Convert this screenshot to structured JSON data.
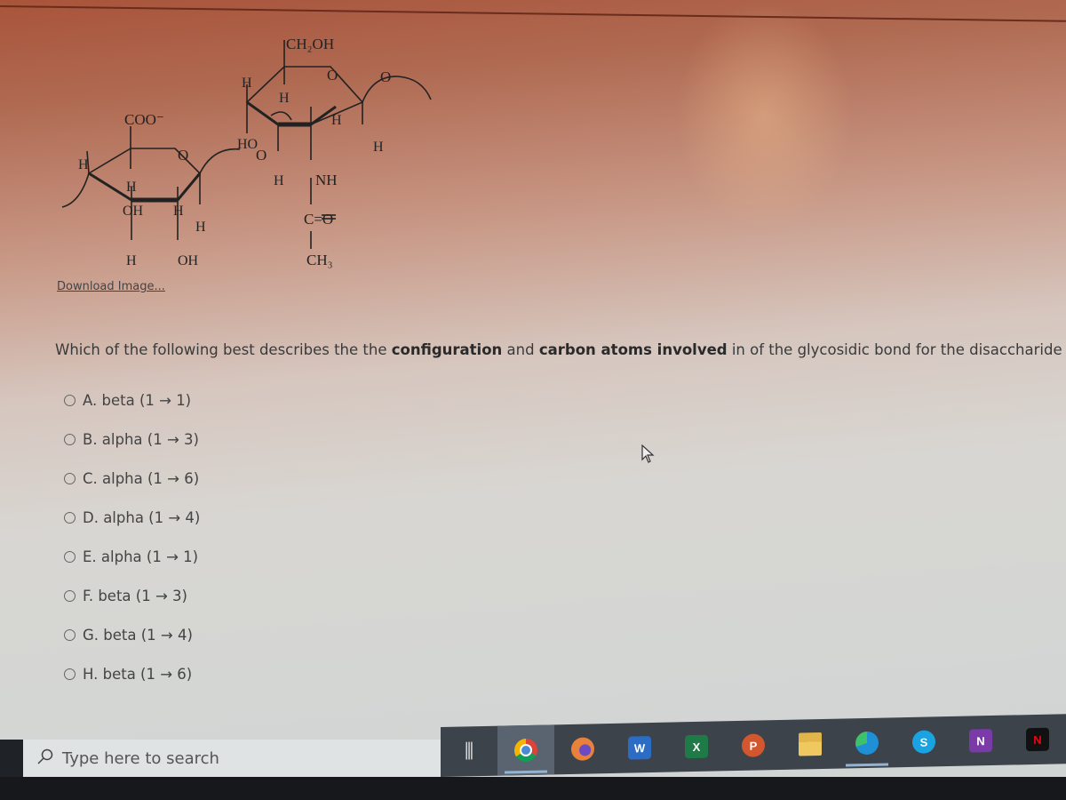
{
  "figure": {
    "labels": {
      "ch2oh": "CH₂OH",
      "coo": "COO⁻",
      "ho": "HO",
      "nh": "NH",
      "co": "C=O",
      "ch3": "CH₃",
      "oh": "OH",
      "h": "H",
      "o": "O"
    },
    "download_link": "Download Image..."
  },
  "question": {
    "part1": "Which of the following best describes the the ",
    "bold1": "configuration",
    "part2": " and ",
    "bold2": "carbon atoms involved",
    "part3": " in of the glycosidic bond for the disaccharide unit?"
  },
  "options": [
    {
      "label": "A. beta (1 → 1)"
    },
    {
      "label": "B. alpha (1 → 3)"
    },
    {
      "label": "C. alpha (1 → 6)"
    },
    {
      "label": "D. alpha (1 → 4)"
    },
    {
      "label": "E. alpha (1 → 1)"
    },
    {
      "label": "F. beta (1 → 3)"
    },
    {
      "label": "G. beta (1 → 4)"
    },
    {
      "label": "H. beta (1 → 6)"
    }
  ],
  "taskbar": {
    "search_placeholder": "Type here to search",
    "apps": [
      {
        "name": "task-view",
        "glyph": "⧉"
      },
      {
        "name": "chrome",
        "glyph": "",
        "color": "#4a8ad4",
        "active": true
      },
      {
        "name": "firefox",
        "glyph": "",
        "color": "#e8813a"
      },
      {
        "name": "word",
        "glyph": "W",
        "color": "#2b6cc4"
      },
      {
        "name": "excel",
        "glyph": "X",
        "color": "#1e7a46"
      },
      {
        "name": "powerpoint",
        "glyph": "P",
        "color": "#d2572e"
      },
      {
        "name": "file-explorer",
        "glyph": "",
        "color": "#e2b54a"
      },
      {
        "name": "edge",
        "glyph": "",
        "color": "#1f8fd6",
        "underline": true
      },
      {
        "name": "skype",
        "glyph": "S",
        "color": "#1aa3e0"
      },
      {
        "name": "onenote",
        "glyph": "N",
        "color": "#7a3aa8"
      },
      {
        "name": "netflix",
        "glyph": "N",
        "color": "#111111",
        "glyph_color": "#e50914"
      }
    ]
  }
}
